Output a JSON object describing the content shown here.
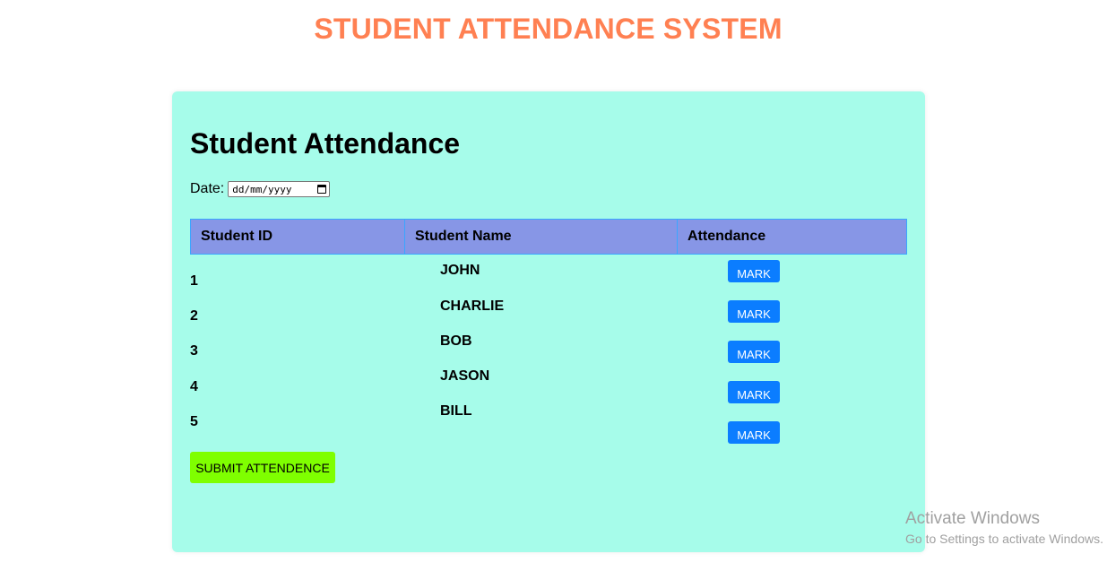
{
  "header": {
    "title": "STUDENT ATTENDANCE SYSTEM"
  },
  "card": {
    "title": "Student Attendance",
    "date_label": "Date:",
    "date_placeholder": "dd/mm/yyyy"
  },
  "table": {
    "columns": [
      "Student ID",
      "Student Name",
      "Attendance"
    ],
    "rows": [
      {
        "id": "1",
        "name": "JOHN",
        "action": "MARK"
      },
      {
        "id": "2",
        "name": "CHARLIE",
        "action": "MARK"
      },
      {
        "id": "3",
        "name": "BOB",
        "action": "MARK"
      },
      {
        "id": "4",
        "name": "JASON",
        "action": "MARK"
      },
      {
        "id": "5",
        "name": "BILL",
        "action": "MARK"
      }
    ]
  },
  "submit_label": "SUBMIT ATTENDENCE",
  "watermark": {
    "title": "Activate Windows",
    "subtitle": "Go to Settings to activate Windows."
  },
  "colors": {
    "title": "#ff8052",
    "card_bg": "#a6fcea",
    "header_bg": "#8796e6",
    "mark_button": "#0b7dff",
    "submit_button": "#7fff00"
  },
  "icons": {
    "date_picker": "calendar-icon"
  }
}
